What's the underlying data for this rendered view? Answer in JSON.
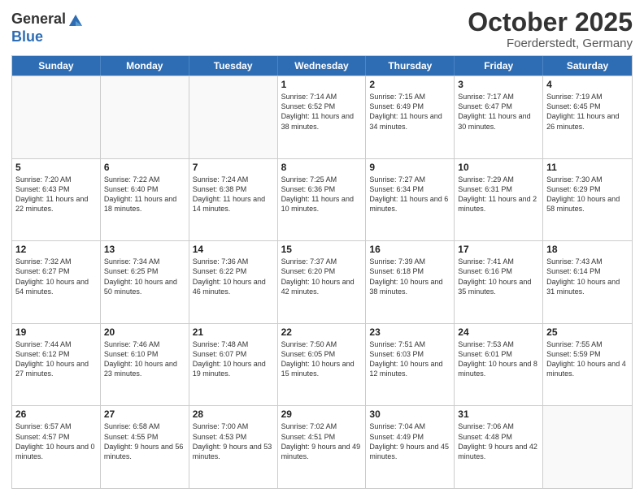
{
  "header": {
    "logo_general": "General",
    "logo_blue": "Blue",
    "month_title": "October 2025",
    "location": "Foerderstedt, Germany"
  },
  "days_of_week": [
    "Sunday",
    "Monday",
    "Tuesday",
    "Wednesday",
    "Thursday",
    "Friday",
    "Saturday"
  ],
  "weeks": [
    [
      {
        "date": "",
        "sunrise": "",
        "sunset": "",
        "daylight": "",
        "empty": true
      },
      {
        "date": "",
        "sunrise": "",
        "sunset": "",
        "daylight": "",
        "empty": true
      },
      {
        "date": "",
        "sunrise": "",
        "sunset": "",
        "daylight": "",
        "empty": true
      },
      {
        "date": "1",
        "sunrise": "Sunrise: 7:14 AM",
        "sunset": "Sunset: 6:52 PM",
        "daylight": "Daylight: 11 hours and 38 minutes.",
        "empty": false
      },
      {
        "date": "2",
        "sunrise": "Sunrise: 7:15 AM",
        "sunset": "Sunset: 6:49 PM",
        "daylight": "Daylight: 11 hours and 34 minutes.",
        "empty": false
      },
      {
        "date": "3",
        "sunrise": "Sunrise: 7:17 AM",
        "sunset": "Sunset: 6:47 PM",
        "daylight": "Daylight: 11 hours and 30 minutes.",
        "empty": false
      },
      {
        "date": "4",
        "sunrise": "Sunrise: 7:19 AM",
        "sunset": "Sunset: 6:45 PM",
        "daylight": "Daylight: 11 hours and 26 minutes.",
        "empty": false
      }
    ],
    [
      {
        "date": "5",
        "sunrise": "Sunrise: 7:20 AM",
        "sunset": "Sunset: 6:43 PM",
        "daylight": "Daylight: 11 hours and 22 minutes.",
        "empty": false
      },
      {
        "date": "6",
        "sunrise": "Sunrise: 7:22 AM",
        "sunset": "Sunset: 6:40 PM",
        "daylight": "Daylight: 11 hours and 18 minutes.",
        "empty": false
      },
      {
        "date": "7",
        "sunrise": "Sunrise: 7:24 AM",
        "sunset": "Sunset: 6:38 PM",
        "daylight": "Daylight: 11 hours and 14 minutes.",
        "empty": false
      },
      {
        "date": "8",
        "sunrise": "Sunrise: 7:25 AM",
        "sunset": "Sunset: 6:36 PM",
        "daylight": "Daylight: 11 hours and 10 minutes.",
        "empty": false
      },
      {
        "date": "9",
        "sunrise": "Sunrise: 7:27 AM",
        "sunset": "Sunset: 6:34 PM",
        "daylight": "Daylight: 11 hours and 6 minutes.",
        "empty": false
      },
      {
        "date": "10",
        "sunrise": "Sunrise: 7:29 AM",
        "sunset": "Sunset: 6:31 PM",
        "daylight": "Daylight: 11 hours and 2 minutes.",
        "empty": false
      },
      {
        "date": "11",
        "sunrise": "Sunrise: 7:30 AM",
        "sunset": "Sunset: 6:29 PM",
        "daylight": "Daylight: 10 hours and 58 minutes.",
        "empty": false
      }
    ],
    [
      {
        "date": "12",
        "sunrise": "Sunrise: 7:32 AM",
        "sunset": "Sunset: 6:27 PM",
        "daylight": "Daylight: 10 hours and 54 minutes.",
        "empty": false
      },
      {
        "date": "13",
        "sunrise": "Sunrise: 7:34 AM",
        "sunset": "Sunset: 6:25 PM",
        "daylight": "Daylight: 10 hours and 50 minutes.",
        "empty": false
      },
      {
        "date": "14",
        "sunrise": "Sunrise: 7:36 AM",
        "sunset": "Sunset: 6:22 PM",
        "daylight": "Daylight: 10 hours and 46 minutes.",
        "empty": false
      },
      {
        "date": "15",
        "sunrise": "Sunrise: 7:37 AM",
        "sunset": "Sunset: 6:20 PM",
        "daylight": "Daylight: 10 hours and 42 minutes.",
        "empty": false
      },
      {
        "date": "16",
        "sunrise": "Sunrise: 7:39 AM",
        "sunset": "Sunset: 6:18 PM",
        "daylight": "Daylight: 10 hours and 38 minutes.",
        "empty": false
      },
      {
        "date": "17",
        "sunrise": "Sunrise: 7:41 AM",
        "sunset": "Sunset: 6:16 PM",
        "daylight": "Daylight: 10 hours and 35 minutes.",
        "empty": false
      },
      {
        "date": "18",
        "sunrise": "Sunrise: 7:43 AM",
        "sunset": "Sunset: 6:14 PM",
        "daylight": "Daylight: 10 hours and 31 minutes.",
        "empty": false
      }
    ],
    [
      {
        "date": "19",
        "sunrise": "Sunrise: 7:44 AM",
        "sunset": "Sunset: 6:12 PM",
        "daylight": "Daylight: 10 hours and 27 minutes.",
        "empty": false
      },
      {
        "date": "20",
        "sunrise": "Sunrise: 7:46 AM",
        "sunset": "Sunset: 6:10 PM",
        "daylight": "Daylight: 10 hours and 23 minutes.",
        "empty": false
      },
      {
        "date": "21",
        "sunrise": "Sunrise: 7:48 AM",
        "sunset": "Sunset: 6:07 PM",
        "daylight": "Daylight: 10 hours and 19 minutes.",
        "empty": false
      },
      {
        "date": "22",
        "sunrise": "Sunrise: 7:50 AM",
        "sunset": "Sunset: 6:05 PM",
        "daylight": "Daylight: 10 hours and 15 minutes.",
        "empty": false
      },
      {
        "date": "23",
        "sunrise": "Sunrise: 7:51 AM",
        "sunset": "Sunset: 6:03 PM",
        "daylight": "Daylight: 10 hours and 12 minutes.",
        "empty": false
      },
      {
        "date": "24",
        "sunrise": "Sunrise: 7:53 AM",
        "sunset": "Sunset: 6:01 PM",
        "daylight": "Daylight: 10 hours and 8 minutes.",
        "empty": false
      },
      {
        "date": "25",
        "sunrise": "Sunrise: 7:55 AM",
        "sunset": "Sunset: 5:59 PM",
        "daylight": "Daylight: 10 hours and 4 minutes.",
        "empty": false
      }
    ],
    [
      {
        "date": "26",
        "sunrise": "Sunrise: 6:57 AM",
        "sunset": "Sunset: 4:57 PM",
        "daylight": "Daylight: 10 hours and 0 minutes.",
        "empty": false
      },
      {
        "date": "27",
        "sunrise": "Sunrise: 6:58 AM",
        "sunset": "Sunset: 4:55 PM",
        "daylight": "Daylight: 9 hours and 56 minutes.",
        "empty": false
      },
      {
        "date": "28",
        "sunrise": "Sunrise: 7:00 AM",
        "sunset": "Sunset: 4:53 PM",
        "daylight": "Daylight: 9 hours and 53 minutes.",
        "empty": false
      },
      {
        "date": "29",
        "sunrise": "Sunrise: 7:02 AM",
        "sunset": "Sunset: 4:51 PM",
        "daylight": "Daylight: 9 hours and 49 minutes.",
        "empty": false
      },
      {
        "date": "30",
        "sunrise": "Sunrise: 7:04 AM",
        "sunset": "Sunset: 4:49 PM",
        "daylight": "Daylight: 9 hours and 45 minutes.",
        "empty": false
      },
      {
        "date": "31",
        "sunrise": "Sunrise: 7:06 AM",
        "sunset": "Sunset: 4:48 PM",
        "daylight": "Daylight: 9 hours and 42 minutes.",
        "empty": false
      },
      {
        "date": "",
        "sunrise": "",
        "sunset": "",
        "daylight": "",
        "empty": true
      }
    ]
  ]
}
